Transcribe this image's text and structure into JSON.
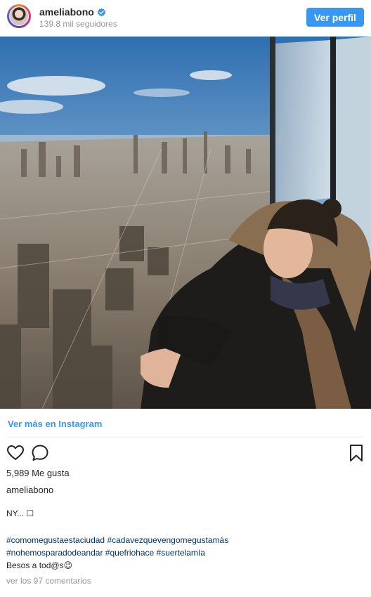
{
  "header": {
    "username": "ameliabono",
    "followers": "139.8 mil seguidores",
    "view_profile_label": "Ver perfil"
  },
  "post": {
    "view_more_label": "Ver más en Instagram",
    "likes": "5,989 Me gusta",
    "caption_user": "ameliabono",
    "caption_line1": "NY... ☐",
    "hashtags_line1": [
      "#comomegustaestaciudad",
      "#cadavezquevengomegustamás"
    ],
    "hashtags_line2": [
      "#nohemosparadodeandar",
      "#quefriohace",
      "#suertelamía"
    ],
    "caption_last": "Besos a tod@s😉",
    "comments_link": "ver los 97 comentarios"
  },
  "icons": {
    "verified": "verified-badge-icon",
    "like": "heart-icon",
    "comment": "comment-icon",
    "save": "bookmark-icon"
  },
  "colors": {
    "accent": "#3897f0",
    "hashtag": "#003569",
    "muted": "#999999"
  }
}
